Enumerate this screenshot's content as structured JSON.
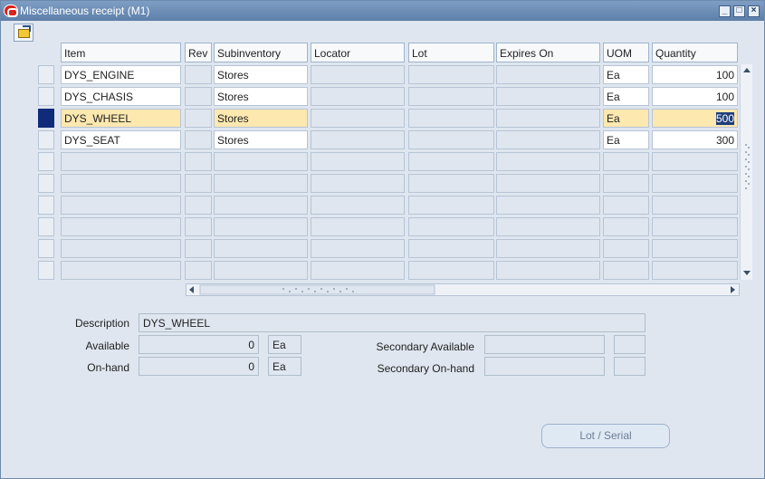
{
  "window": {
    "title": "Miscellaneous receipt (M1)"
  },
  "titlebar_buttons": [
    "minimize",
    "maximize",
    "close"
  ],
  "toolbar": {
    "open_icon": "folder-open-icon"
  },
  "columns": [
    "Item",
    "Rev",
    "Subinventory",
    "Locator",
    "Lot",
    "Expires On",
    "UOM",
    "Quantity"
  ],
  "rows": [
    {
      "item": "DYS_ENGINE",
      "rev": "",
      "subinventory": "Stores",
      "locator": "",
      "lot": "",
      "expires_on": "",
      "uom": "Ea",
      "quantity": "100"
    },
    {
      "item": "DYS_CHASIS",
      "rev": "",
      "subinventory": "Stores",
      "locator": "",
      "lot": "",
      "expires_on": "",
      "uom": "Ea",
      "quantity": "100"
    },
    {
      "item": "DYS_WHEEL",
      "rev": "",
      "subinventory": "Stores",
      "locator": "",
      "lot": "",
      "expires_on": "",
      "uom": "Ea",
      "quantity": "500"
    },
    {
      "item": "DYS_SEAT",
      "rev": "",
      "subinventory": "Stores",
      "locator": "",
      "lot": "",
      "expires_on": "",
      "uom": "Ea",
      "quantity": "300"
    }
  ],
  "selected_row": 3,
  "details": {
    "description_label": "Description",
    "description_value": "DYS_WHEEL",
    "available_label": "Available",
    "available_value": "0",
    "available_uom": "Ea",
    "onhand_label": "On-hand",
    "onhand_value": "0",
    "onhand_uom": "Ea",
    "secondary_available_label": "Secondary Available",
    "secondary_available_value": "",
    "secondary_available_uom": "",
    "secondary_onhand_label": "Secondary On-hand",
    "secondary_onhand_value": "",
    "secondary_onhand_uom": ""
  },
  "buttons": {
    "lot_serial": "Lot / Serial"
  },
  "colors": {
    "title_bar": "#5d7fa9",
    "background": "#dfe6ef",
    "selected_row_fill": "#fde8b0",
    "row_indicator": "#102b7a"
  }
}
